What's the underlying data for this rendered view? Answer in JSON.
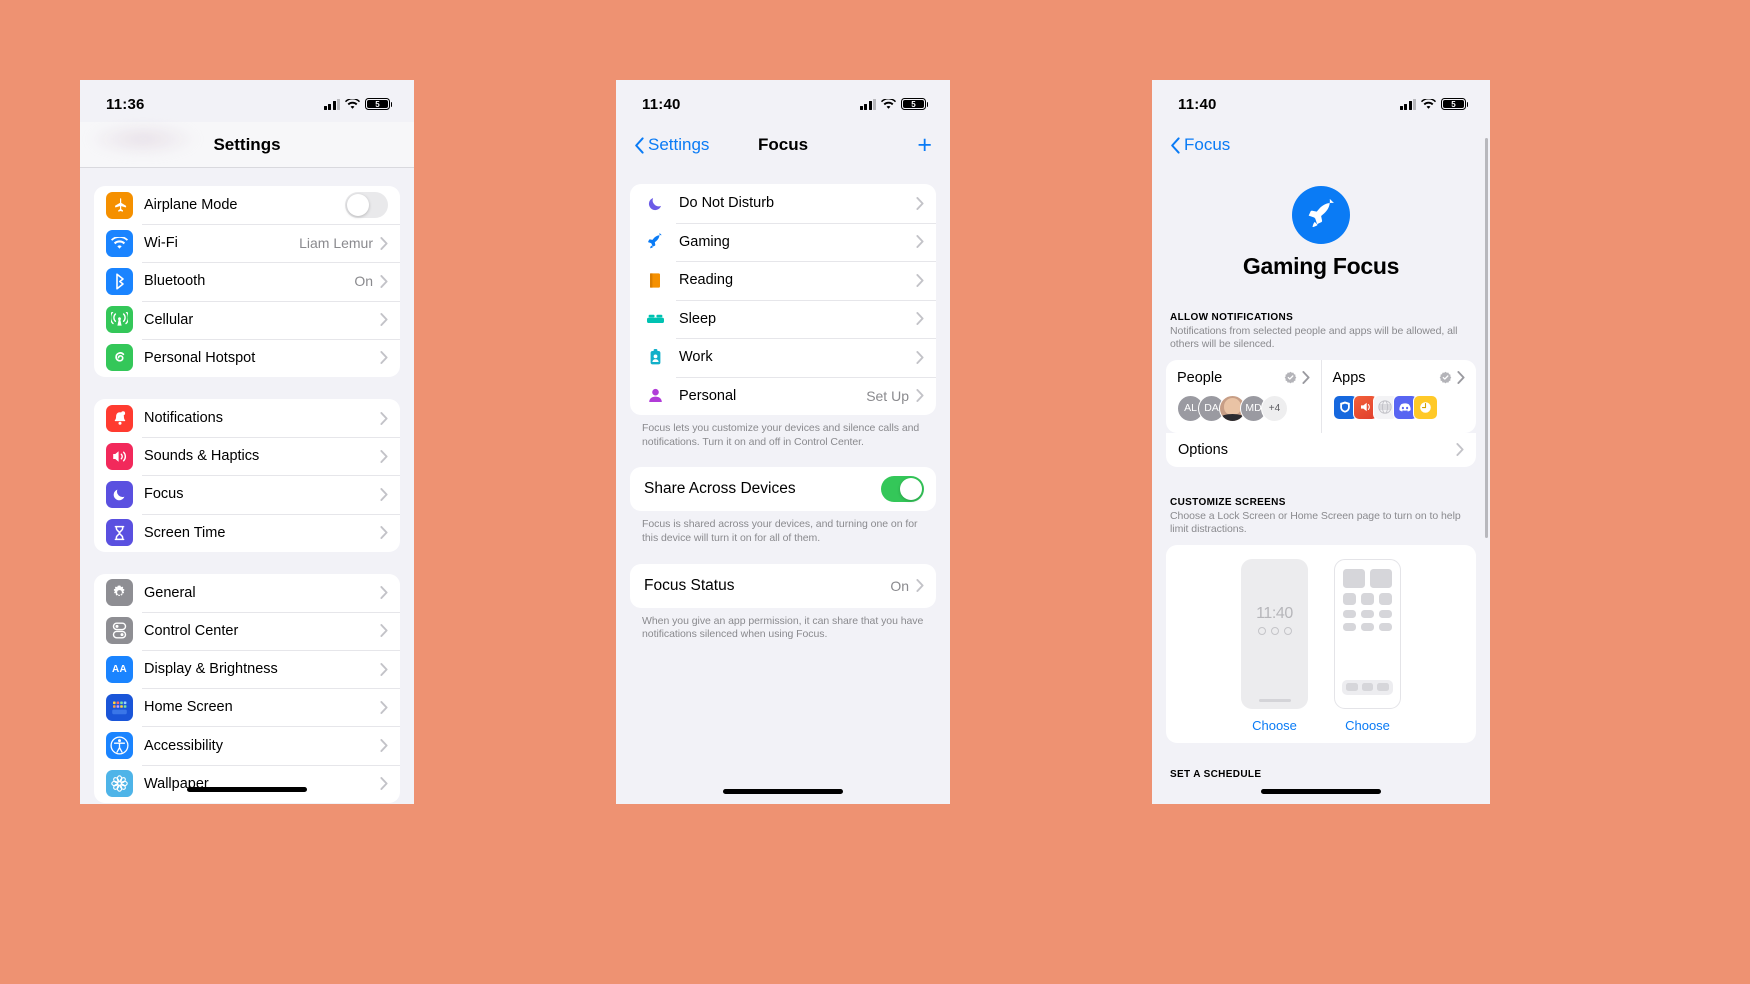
{
  "colors": {
    "background": "#ee9272",
    "accent_blue": "#0a7bf5",
    "toggle_green": "#34c759",
    "panel": "#f2f2f7",
    "card": "#ffffff",
    "secondary_text": "#8a8a8e"
  },
  "phone1": {
    "status": {
      "time": "11:36",
      "battery": "5",
      "signal_icon": "cellular-bars-icon",
      "wifi_icon": "wifi-icon",
      "battery_icon": "battery-icon"
    },
    "nav": {
      "title": "Settings"
    },
    "groups": [
      {
        "rows": [
          {
            "label": "Airplane Mode",
            "icon": "airplane-icon",
            "icon_color": "#f59000",
            "control": "toggle",
            "toggle_on": false
          },
          {
            "label": "Wi-Fi",
            "icon": "wifi-icon",
            "icon_color": "#1a84ff",
            "value": "Liam Lemur",
            "control": "chevron"
          },
          {
            "label": "Bluetooth",
            "icon": "bluetooth-icon",
            "icon_color": "#1a84ff",
            "value": "On",
            "control": "chevron"
          },
          {
            "label": "Cellular",
            "icon": "cellular-antenna-icon",
            "icon_color": "#34c759",
            "value": "",
            "control": "chevron"
          },
          {
            "label": "Personal Hotspot",
            "icon": "hotspot-icon",
            "icon_color": "#34c759",
            "value": "",
            "control": "chevron"
          }
        ]
      },
      {
        "rows": [
          {
            "label": "Notifications",
            "icon": "bell-icon",
            "icon_color": "#ff3b30",
            "value": "",
            "control": "chevron"
          },
          {
            "label": "Sounds & Haptics",
            "icon": "speaker-icon",
            "icon_color": "#f2295b",
            "value": "",
            "control": "chevron"
          },
          {
            "label": "Focus",
            "icon": "moon-icon",
            "icon_color": "#5a50e0",
            "value": "",
            "control": "chevron"
          },
          {
            "label": "Screen Time",
            "icon": "hourglass-icon",
            "icon_color": "#5a50e0",
            "value": "",
            "control": "chevron"
          }
        ]
      },
      {
        "rows": [
          {
            "label": "General",
            "icon": "gear-icon",
            "icon_color": "#8e8e93",
            "value": "",
            "control": "chevron"
          },
          {
            "label": "Control Center",
            "icon": "control-center-icon",
            "icon_color": "#8e8e93",
            "value": "",
            "control": "chevron"
          },
          {
            "label": "Display & Brightness",
            "icon": "aa-text-icon",
            "icon_color": "#1a84ff",
            "value": "",
            "control": "chevron"
          },
          {
            "label": "Home Screen",
            "icon": "home-screen-grid-icon",
            "icon_color": "#1a55d8",
            "value": "",
            "control": "chevron"
          },
          {
            "label": "Accessibility",
            "icon": "accessibility-icon",
            "icon_color": "#1a84ff",
            "value": "",
            "control": "chevron"
          },
          {
            "label": "Wallpaper",
            "icon": "wallpaper-flower-icon",
            "icon_color": "#4eb4e8",
            "value": "",
            "control": "chevron"
          }
        ]
      }
    ]
  },
  "phone2": {
    "status": {
      "time": "11:40",
      "battery": "5"
    },
    "nav": {
      "back_label": "Settings",
      "title": "Focus",
      "add_label": "+"
    },
    "focus_modes": [
      {
        "label": "Do Not Disturb",
        "icon": "moon-icon",
        "icon_color": "#6c5ce7",
        "value": ""
      },
      {
        "label": "Gaming",
        "icon": "rocket-icon",
        "icon_color": "#0a7bf5",
        "value": ""
      },
      {
        "label": "Reading",
        "icon": "book-icon",
        "icon_color": "#f59000",
        "value": ""
      },
      {
        "label": "Sleep",
        "icon": "bed-icon",
        "icon_color": "#00c2b2",
        "value": ""
      },
      {
        "label": "Work",
        "icon": "badge-id-icon",
        "icon_color": "#12b0c9",
        "value": ""
      },
      {
        "label": "Personal",
        "icon": "person-icon",
        "icon_color": "#b13bd8",
        "value": "Set Up"
      }
    ],
    "focus_footnote": "Focus lets you customize your devices and silence calls and notifications. Turn it on and off in Control Center.",
    "share": {
      "label": "Share Across Devices",
      "toggle_on": true
    },
    "share_footnote": "Focus is shared across your devices, and turning one on for this device will turn it on for all of them.",
    "status_row": {
      "label": "Focus Status",
      "value": "On"
    },
    "status_footnote": "When you give an app permission, it can share that you have notifications silenced when using Focus."
  },
  "phone3": {
    "status": {
      "time": "11:40",
      "battery": "5"
    },
    "nav": {
      "back_label": "Focus"
    },
    "hero": {
      "title": "Gaming Focus",
      "icon": "rocket-icon",
      "icon_bg": "#0a7bf5"
    },
    "allow": {
      "heading": "ALLOW NOTIFICATIONS",
      "subtext": "Notifications from selected people and apps will be allowed, all others will be silenced.",
      "people": {
        "title": "People",
        "seal_icon": "check-seal-icon",
        "avatars": [
          "AL",
          "DA",
          "photo",
          "MD",
          "+4"
        ]
      },
      "apps": {
        "title": "Apps",
        "seal_icon": "check-seal-icon",
        "icons": [
          "shield-app-icon",
          "megaphone-app-icon",
          "globe-app-icon",
          "discord-app-icon",
          "clock-app-icon"
        ]
      },
      "options_label": "Options"
    },
    "customize": {
      "heading": "CUSTOMIZE SCREENS",
      "subtext": "Choose a Lock Screen or Home Screen page to turn on to help limit distractions.",
      "lock_screen": {
        "time": "11:40",
        "choose_label": "Choose"
      },
      "home_screen": {
        "choose_label": "Choose"
      }
    },
    "schedule": {
      "heading": "SET A SCHEDULE"
    }
  }
}
